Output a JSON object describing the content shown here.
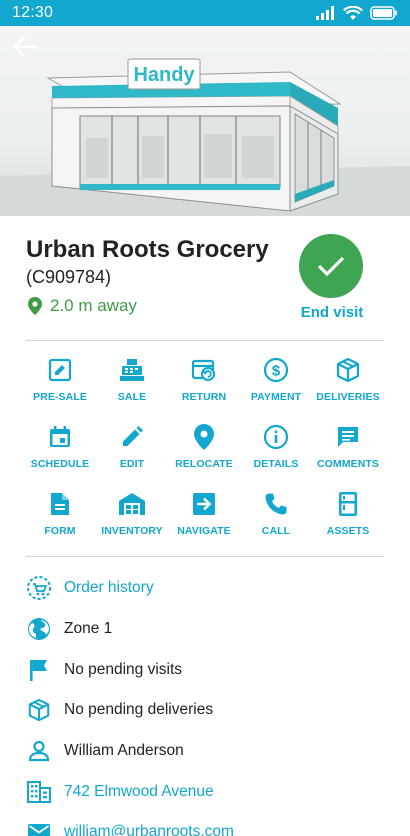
{
  "status_bar": {
    "time": "12:30"
  },
  "hero": {
    "sign_text": "Handy"
  },
  "store": {
    "name": "Urban Roots Grocery",
    "code": "(C909784)",
    "distance": "2.0 m away"
  },
  "end_visit": {
    "label": "End visit"
  },
  "actions": [
    {
      "label": "PRE-SALE",
      "icon": "edit-box-icon"
    },
    {
      "label": "SALE",
      "icon": "cash-register-icon"
    },
    {
      "label": "RETURN",
      "icon": "return-icon"
    },
    {
      "label": "PAYMENT",
      "icon": "dollar-circle-icon"
    },
    {
      "label": "DELIVERIES",
      "icon": "package-icon"
    },
    {
      "label": "SCHEDULE",
      "icon": "calendar-icon"
    },
    {
      "label": "EDIT",
      "icon": "pencil-icon"
    },
    {
      "label": "RELOCATE",
      "icon": "map-pin-icon"
    },
    {
      "label": "DETAILS",
      "icon": "info-icon"
    },
    {
      "label": "COMMENTS",
      "icon": "comment-icon"
    },
    {
      "label": "FORM",
      "icon": "document-icon"
    },
    {
      "label": "INVENTORY",
      "icon": "warehouse-icon"
    },
    {
      "label": "NAVIGATE",
      "icon": "navigate-icon"
    },
    {
      "label": "CALL",
      "icon": "phone-icon"
    },
    {
      "label": "ASSETS",
      "icon": "fridge-icon"
    }
  ],
  "info": {
    "order_history": "Order history",
    "zone": "Zone 1",
    "visits": "No pending visits",
    "deliveries": "No pending deliveries",
    "contact": "William Anderson",
    "address": "742 Elmwood Avenue",
    "email": "william@urbanroots.com"
  },
  "colors": {
    "accent": "#11a7cf",
    "success": "#3fa553",
    "distance": "#3e9a47"
  }
}
